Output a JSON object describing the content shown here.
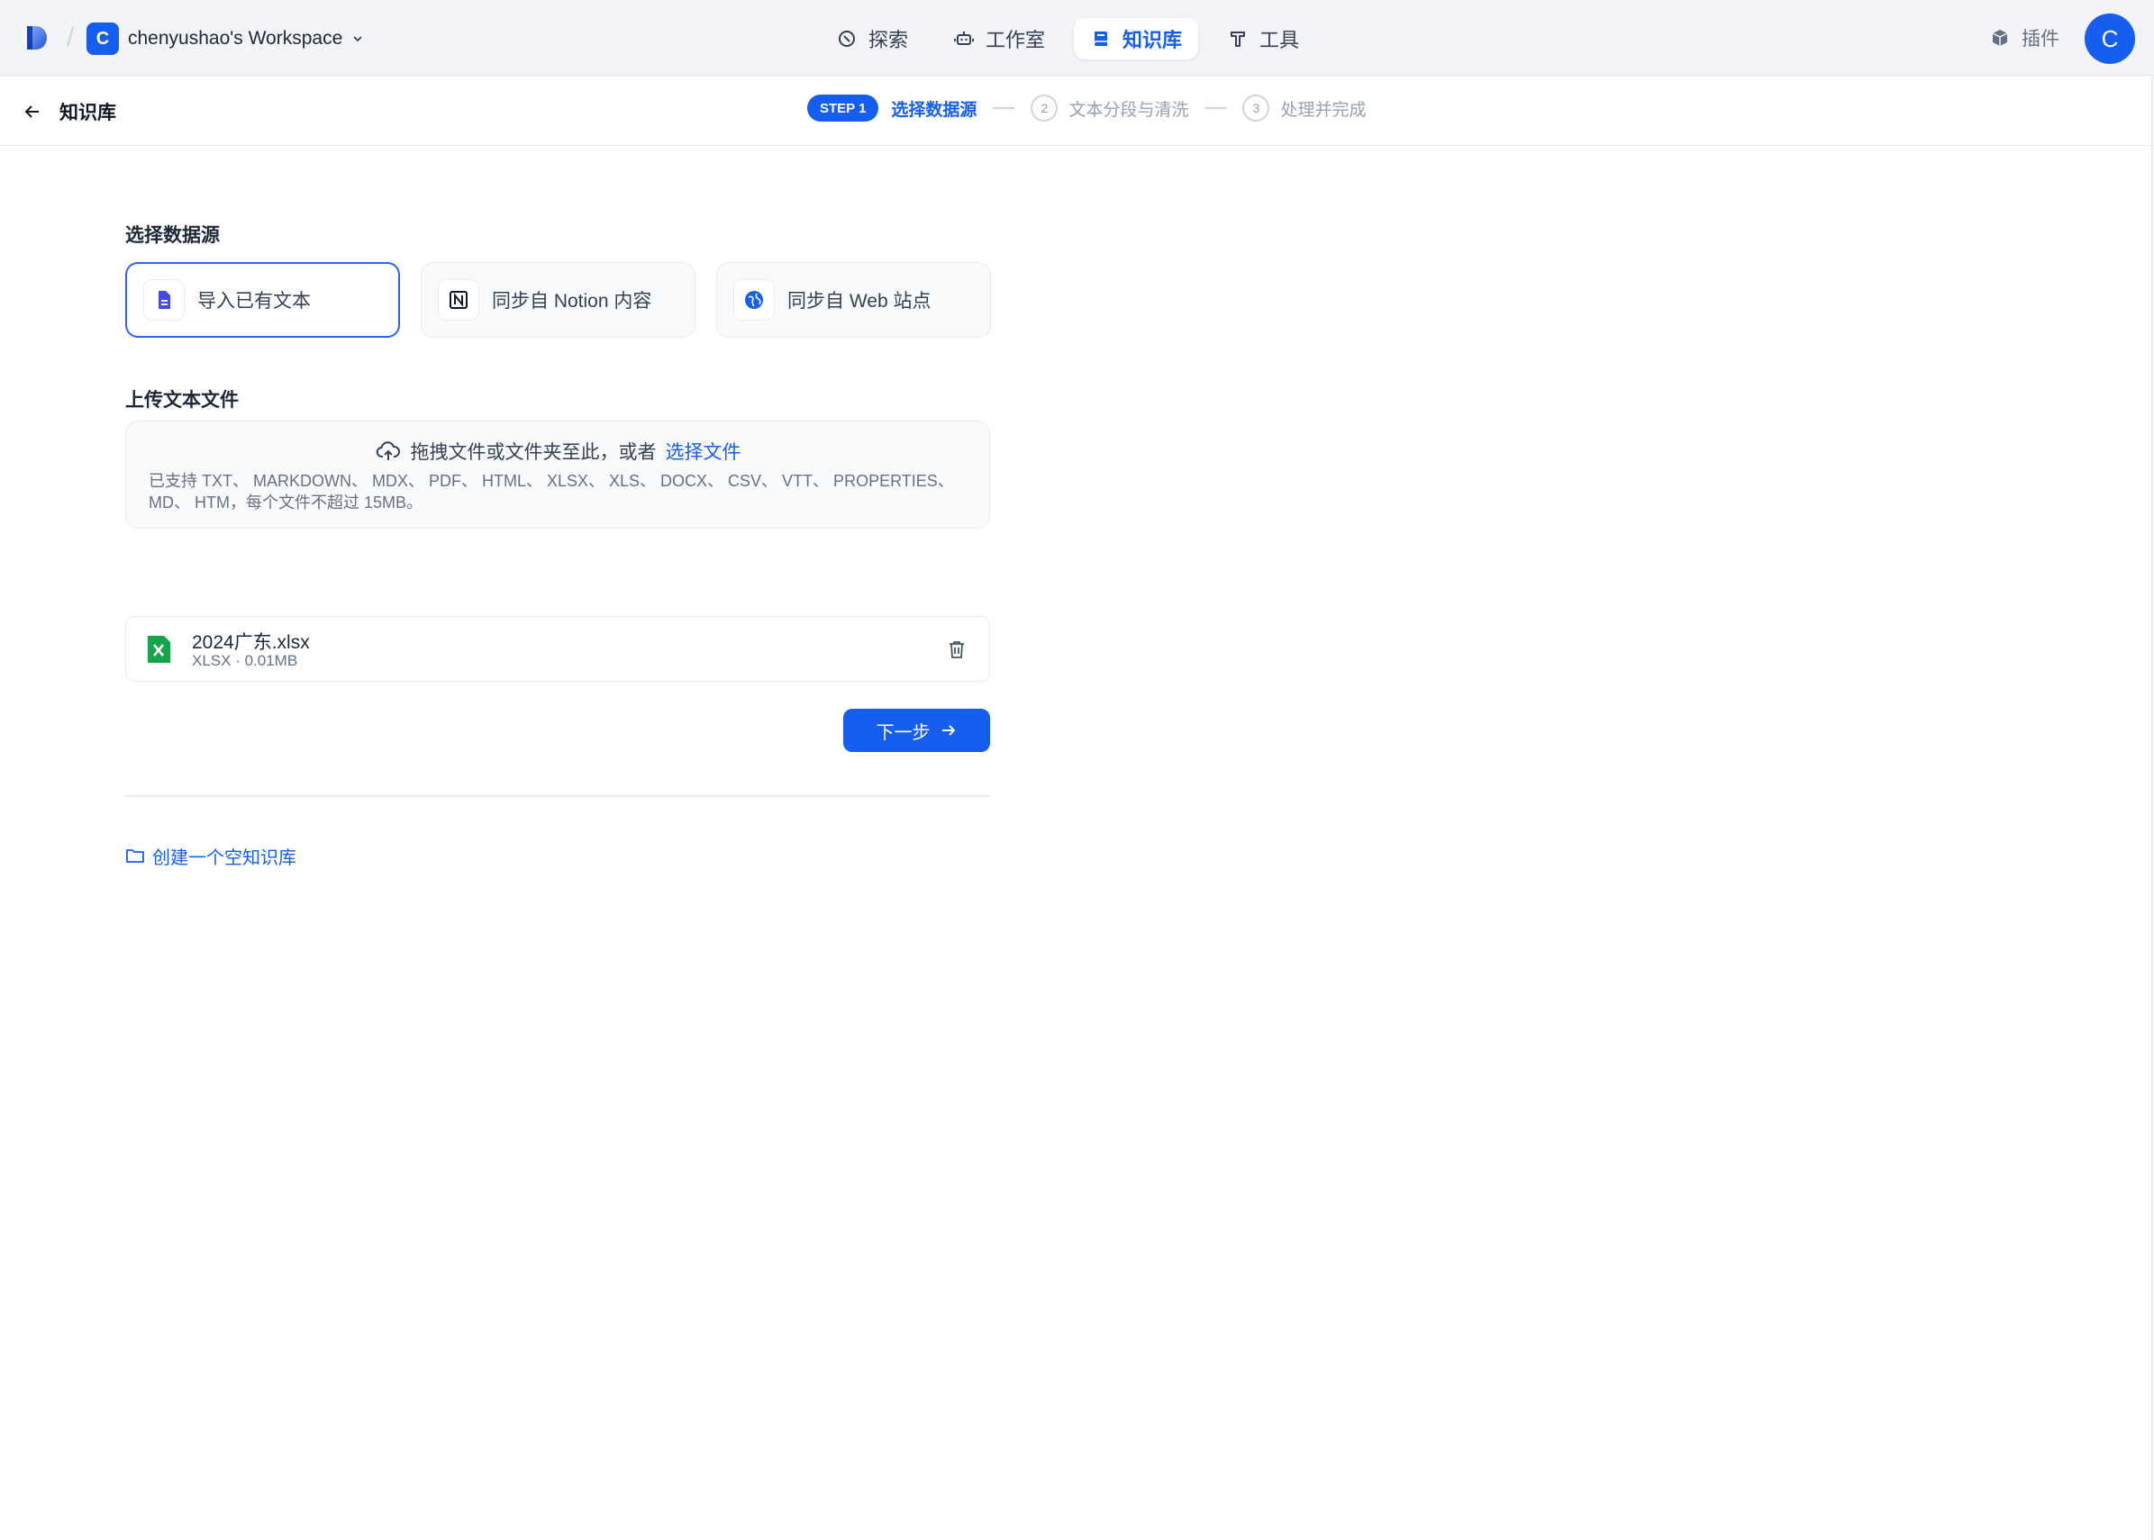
{
  "workspace": {
    "badge": "C",
    "name": "chenyushao's Workspace",
    "chevron_icon": "chevron-down-icon"
  },
  "nav": [
    {
      "label": "探索",
      "icon": "compass-icon",
      "active": false
    },
    {
      "label": "工作室",
      "icon": "robot-icon",
      "active": false
    },
    {
      "label": "知识库",
      "icon": "book-icon",
      "active": true
    },
    {
      "label": "工具",
      "icon": "hammer-icon",
      "active": false
    }
  ],
  "plugins": {
    "label": "插件",
    "icon": "cube-icon"
  },
  "avatar": {
    "initial": "C"
  },
  "subheader": {
    "title": "知识库",
    "back_icon": "arrow-left-icon"
  },
  "steps": {
    "active_pill": "STEP 1",
    "active_label": "选择数据源",
    "step2_num": "2",
    "step2_label": "文本分段与清洗",
    "step3_num": "3",
    "step3_label": "处理并完成"
  },
  "data_source": {
    "title": "选择数据源",
    "options": [
      {
        "label": "导入已有文本",
        "icon": "document-icon",
        "selected": true
      },
      {
        "label": "同步自 Notion 内容",
        "icon": "notion-icon",
        "selected": false
      },
      {
        "label": "同步自 Web 站点",
        "icon": "globe-icon",
        "selected": false
      }
    ]
  },
  "upload": {
    "title": "上传文本文件",
    "drop_text": "拖拽文件或文件夹至此，或者",
    "select_link": "选择文件",
    "tip": "已支持 TXT、 MARKDOWN、 MDX、 PDF、 HTML、 XLSX、 XLS、 DOCX、 CSV、 VTT、 PROPERTIES、 MD、 HTM，每个文件不超过 15MB。"
  },
  "files": [
    {
      "name": "2024广东.xlsx",
      "meta": "XLSX · 0.01MB",
      "icon": "excel-file-icon"
    }
  ],
  "actions": {
    "next": "下一步",
    "create_empty": "创建一个空知识库"
  },
  "colors": {
    "accent": "#155eef",
    "page_bg": "#f2f4f7",
    "excel_green": "#16a34a"
  }
}
